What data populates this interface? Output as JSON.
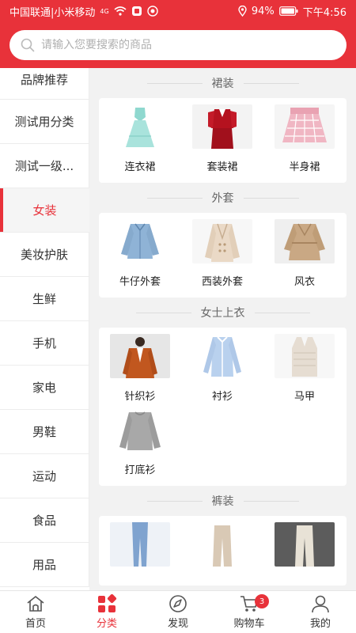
{
  "status_bar": {
    "carrier": "中国联通|小米移动",
    "signal": "4G",
    "battery": "94%",
    "time": "下午4:56"
  },
  "search": {
    "placeholder": "请输入您要搜索的商品"
  },
  "sidebar": {
    "items": [
      {
        "label": "品牌推荐"
      },
      {
        "label": "测试用分类"
      },
      {
        "label": "测试一级..."
      },
      {
        "label": "女装"
      },
      {
        "label": "美妆护肤"
      },
      {
        "label": "生鲜"
      },
      {
        "label": "手机"
      },
      {
        "label": "家电"
      },
      {
        "label": "男鞋"
      },
      {
        "label": "运动"
      },
      {
        "label": "食品"
      },
      {
        "label": "用品"
      }
    ],
    "active_index": 3
  },
  "sections": [
    {
      "title": "裙装",
      "items": [
        {
          "label": "连衣裙"
        },
        {
          "label": "套装裙"
        },
        {
          "label": "半身裙"
        }
      ]
    },
    {
      "title": "外套",
      "items": [
        {
          "label": "牛仔外套"
        },
        {
          "label": "西装外套"
        },
        {
          "label": "风衣"
        }
      ]
    },
    {
      "title": "女士上衣",
      "items": [
        {
          "label": "针织衫"
        },
        {
          "label": "衬衫"
        },
        {
          "label": "马甲"
        },
        {
          "label": "打底衫"
        }
      ]
    },
    {
      "title": "裤装",
      "items": [
        {
          "label": ""
        },
        {
          "label": ""
        },
        {
          "label": ""
        }
      ]
    }
  ],
  "tabbar": {
    "items": [
      {
        "label": "首页",
        "icon": "home-icon"
      },
      {
        "label": "分类",
        "icon": "category-icon"
      },
      {
        "label": "发现",
        "icon": "compass-icon"
      },
      {
        "label": "购物车",
        "icon": "cart-icon",
        "badge": "3"
      },
      {
        "label": "我的",
        "icon": "person-icon"
      }
    ],
    "active_index": 1
  },
  "colors": {
    "accent": "#e8323a"
  }
}
